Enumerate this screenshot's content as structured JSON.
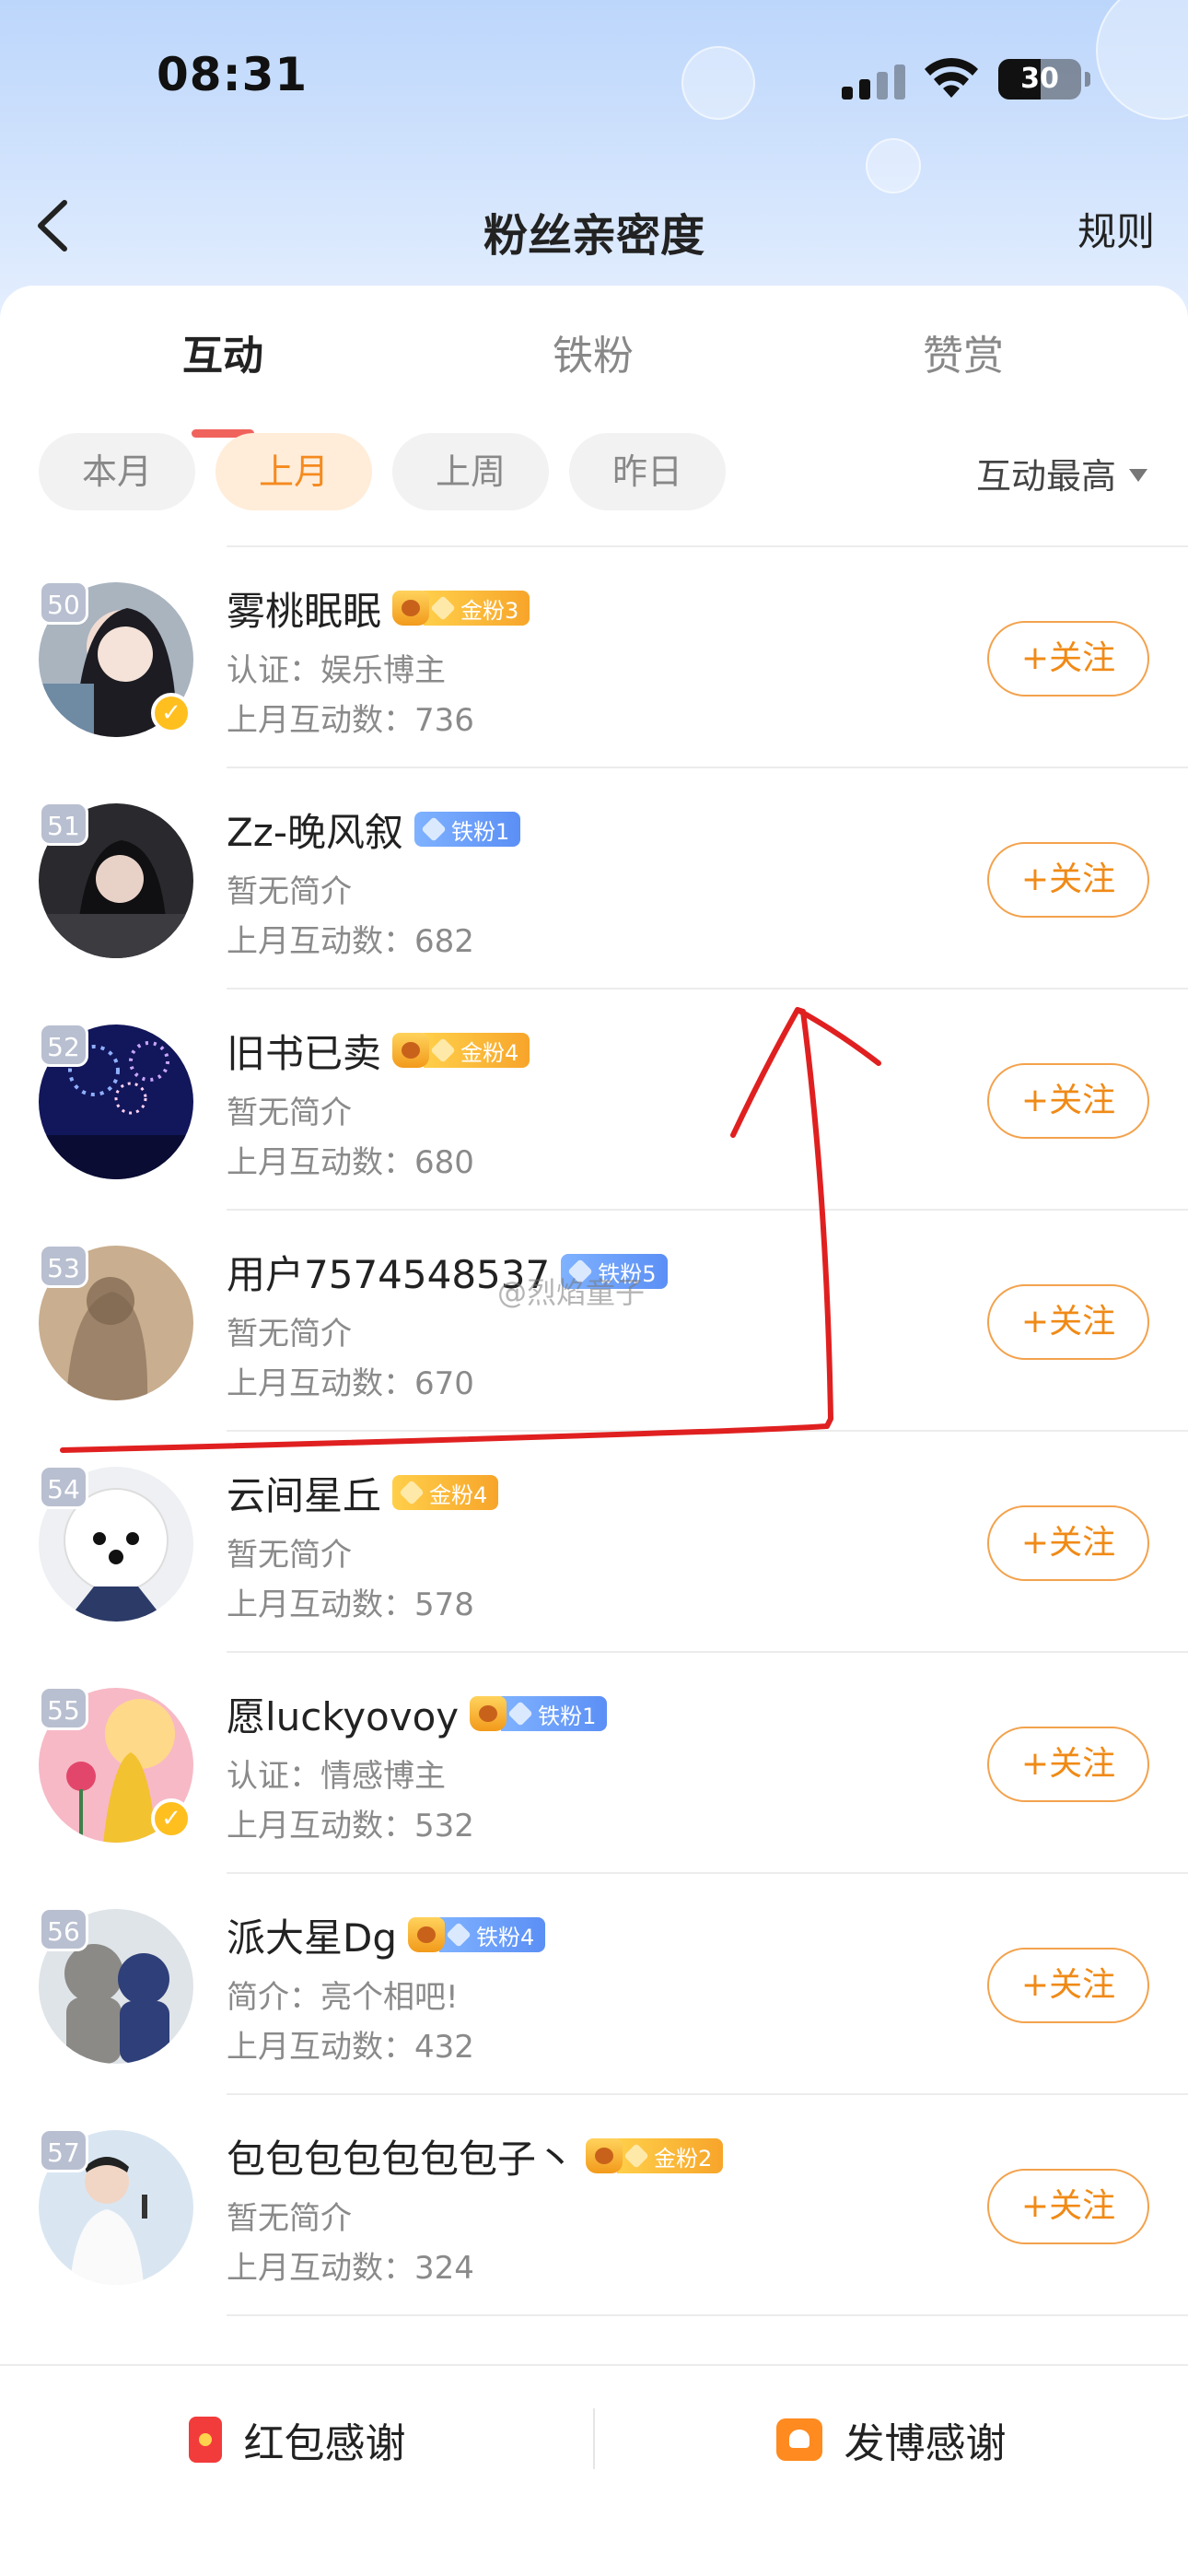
{
  "status_bar": {
    "time": "08:31",
    "battery": "30"
  },
  "nav": {
    "title": "粉丝亲密度",
    "rules_label": "规则"
  },
  "tabs": [
    {
      "label": "互动",
      "active": true
    },
    {
      "label": "铁粉",
      "active": false
    },
    {
      "label": "赞赏",
      "active": false
    }
  ],
  "filters": [
    {
      "label": "本月",
      "active": false
    },
    {
      "label": "上月",
      "active": true
    },
    {
      "label": "上周",
      "active": false
    },
    {
      "label": "昨日",
      "active": false
    }
  ],
  "sort": {
    "label": "互动最高"
  },
  "fans": [
    {
      "rank": "50",
      "name": "雾桃眠眠",
      "badge": "金粉3",
      "badge_type": "gold",
      "crown": true,
      "verified": true,
      "bio": "认证：娱乐博主",
      "count": "上月互动数：736",
      "follow_label": "+关注"
    },
    {
      "rank": "51",
      "name": "Zz-晚风叙",
      "badge": "铁粉1",
      "badge_type": "iron",
      "crown": false,
      "verified": false,
      "bio": "暂无简介",
      "count": "上月互动数：682",
      "follow_label": "+关注"
    },
    {
      "rank": "52",
      "name": "旧书已卖",
      "badge": "金粉4",
      "badge_type": "gold",
      "crown": true,
      "verified": false,
      "bio": "暂无简介",
      "count": "上月互动数：680",
      "follow_label": "+关注"
    },
    {
      "rank": "53",
      "name": "用户7574548537",
      "badge": "铁粉5",
      "badge_type": "iron",
      "crown": false,
      "verified": false,
      "bio": "暂无简介",
      "count": "上月互动数：670",
      "follow_label": "+关注"
    },
    {
      "rank": "54",
      "name": "云间星丘",
      "badge": "金粉4",
      "badge_type": "gold",
      "crown": false,
      "verified": false,
      "bio": "暂无简介",
      "count": "上月互动数：578",
      "follow_label": "+关注"
    },
    {
      "rank": "55",
      "name": "愿luckyovoy",
      "badge": "铁粉1",
      "badge_type": "iron",
      "crown": true,
      "verified": true,
      "bio": "认证：情感博主",
      "count": "上月互动数：532",
      "follow_label": "+关注"
    },
    {
      "rank": "56",
      "name": "派大星Dg",
      "badge": "铁粉4",
      "badge_type": "iron",
      "crown": true,
      "verified": false,
      "bio": "简介：亮个相吧!",
      "count": "上月互动数：432",
      "follow_label": "+关注"
    },
    {
      "rank": "57",
      "name": "包包包包包包包子丶",
      "badge": "金粉2",
      "badge_type": "gold",
      "crown": true,
      "verified": false,
      "bio": "暂无简介",
      "count": "上月互动数：324",
      "follow_label": "+关注"
    }
  ],
  "bottom": {
    "red_packet_label": "红包感谢",
    "post_label": "发博感谢"
  },
  "watermark": "@烈焰童子",
  "colors": {
    "accent": "#f08a16",
    "tab_indicator": "#f0635d",
    "annotation": "#e02020"
  }
}
